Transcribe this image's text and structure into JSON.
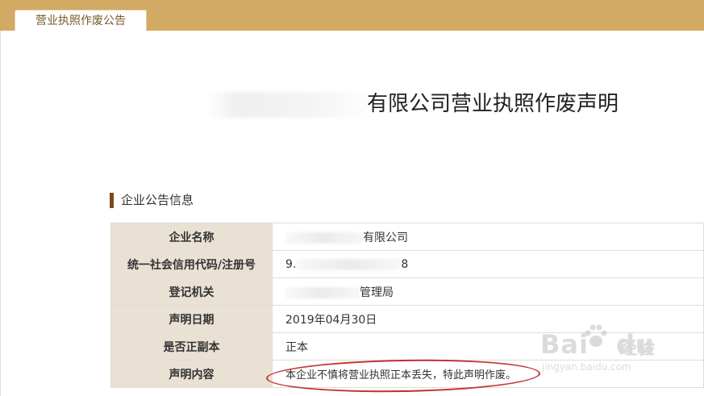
{
  "tab": {
    "label": "营业执照作废公告"
  },
  "title": {
    "text": "有限公司营业执照作废声明"
  },
  "section": {
    "title": "企业公告信息"
  },
  "rows": [
    {
      "label": "企业名称",
      "value": "有限公司"
    },
    {
      "label": "统一社会信用代码/注册号",
      "value_prefix": "9.",
      "value_suffix": "8"
    },
    {
      "label": "登记机关",
      "value": "管理局"
    },
    {
      "label": "声明日期",
      "value": "2019年04月30日"
    },
    {
      "label": "是否正副本",
      "value": "正本"
    },
    {
      "label": "声明内容",
      "value": "本企业不慎将营业执照正本丢失，特此声明作废。"
    }
  ],
  "watermark": {
    "brand": "Bai",
    "brand_tail": "du",
    "jingyan": "经验",
    "url": "jingyan.baidu.com"
  },
  "colors": {
    "band": "#d2aa63",
    "key_bg": "#e9e1d4",
    "section_bar": "#7a4b1e",
    "annotation": "#c03030"
  }
}
